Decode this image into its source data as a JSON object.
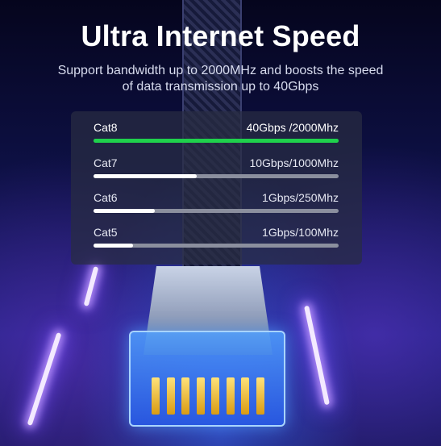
{
  "header": {
    "title": "Ultra Internet Speed",
    "subtitle_line1": "Support bandwidth up to 2000MHz and boosts the speed",
    "subtitle_line2": "of data transmission up to 40Gbps"
  },
  "speeds": [
    {
      "category": "Cat8",
      "speed": "40Gbps /2000Mhz",
      "fill_fraction": 1.0,
      "highlight": true,
      "color": "#1fd14c"
    },
    {
      "category": "Cat7",
      "speed": "10Gbps/1000Mhz",
      "fill_fraction": 0.42,
      "highlight": false,
      "color": "#ffffff"
    },
    {
      "category": "Cat6",
      "speed": "1Gbps/250Mhz",
      "fill_fraction": 0.25,
      "highlight": false,
      "color": "#ffffff"
    },
    {
      "category": "Cat5",
      "speed": "1Gbps/100Mhz",
      "fill_fraction": 0.16,
      "highlight": false,
      "color": "#ffffff"
    }
  ]
}
